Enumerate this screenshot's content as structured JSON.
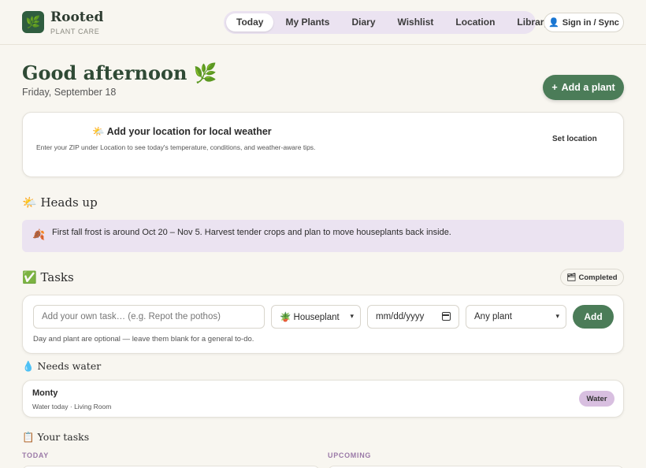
{
  "header": {
    "logo_icon": "leaf-icon",
    "logo_glyph": "🌿",
    "brand_name": "Rooted",
    "brand_sub": "PLANT CARE",
    "nav": [
      {
        "label": "Today",
        "active": true
      },
      {
        "label": "My Plants",
        "active": false
      },
      {
        "label": "Diary",
        "active": false
      },
      {
        "label": "Wishlist",
        "active": false
      },
      {
        "label": "Location",
        "active": false
      },
      {
        "label": "Library",
        "active": false
      }
    ],
    "signin_icon": "👤",
    "signin_label": "Sign in / Sync"
  },
  "greeting": {
    "title": "Good afternoon 🌿",
    "date": "Friday, September 18",
    "add_plant_icon": "+",
    "add_plant_label": "Add a plant"
  },
  "weather": {
    "icon": "🌤️",
    "title": "Add your location for local weather",
    "description": "Enter your ZIP under Location to see today's temperature, conditions, and weather-aware tips.",
    "set_location_label": "Set location"
  },
  "heads_up": {
    "title": "🌤️ Heads up",
    "icon": "🍂",
    "message": "First fall frost is around Oct 20 – Nov 5. Harvest tender crops and plan to move houseplants back inside."
  },
  "tasks": {
    "title": "✅ Tasks",
    "completed_icon": "🗂",
    "completed_label": "Completed",
    "input_placeholder": "Add your own task… (e.g. Repot the pothos)",
    "category_value": "🪴 Houseplant",
    "date_value": "mm/dd/yyyy",
    "plant_value": "Any plant",
    "add_label": "Add",
    "hint": "Day and plant are optional — leave them blank for a general to-do."
  },
  "needs_water": {
    "title": "💧 Needs water",
    "items": [
      {
        "name": "Monty",
        "meta": "Water today · Living Room",
        "action": "Water"
      }
    ]
  },
  "your_tasks": {
    "title": "📋 Your tasks",
    "today_label": "TODAY",
    "upcoming_label": "UPCOMING"
  },
  "colors": {
    "brand_green": "#4b7c58",
    "nav_bg": "#ebe3f1",
    "accent_purple": "#9b7aa8",
    "water_badge": "#d8bfe0"
  }
}
